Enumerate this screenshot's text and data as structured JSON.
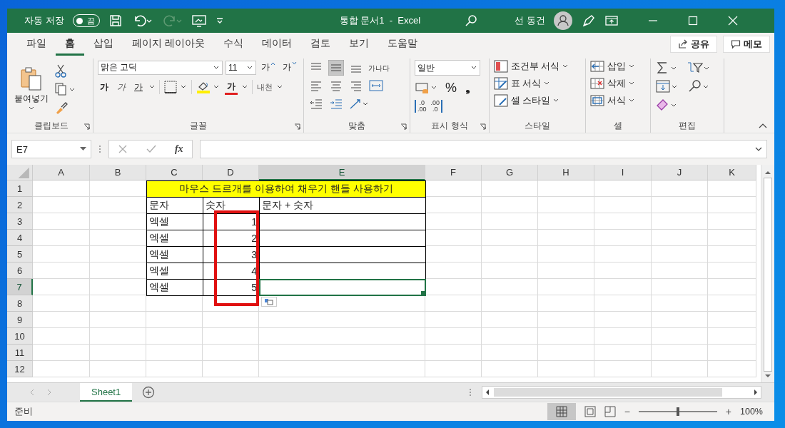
{
  "title_bar": {
    "autosave_label": "자동 저장",
    "autosave": {
      "on": false,
      "label": "끔"
    },
    "document_title": "통합 문서1  -  Excel",
    "user_name": "선 동건"
  },
  "menu_tabs": [
    {
      "label": "파일",
      "selected": false
    },
    {
      "label": "홈",
      "selected": true
    },
    {
      "label": "삽입",
      "selected": false
    },
    {
      "label": "페이지 레이아웃",
      "selected": false
    },
    {
      "label": "수식",
      "selected": false
    },
    {
      "label": "데이터",
      "selected": false
    },
    {
      "label": "검토",
      "selected": false
    },
    {
      "label": "보기",
      "selected": false
    },
    {
      "label": "도움말",
      "selected": false
    }
  ],
  "share_button": "공유",
  "comments_button": "메모",
  "ribbon": {
    "clipboard": {
      "paste_label": "붙여넣기",
      "group_label": "클립보드"
    },
    "font": {
      "font_name": "맑은 고딕",
      "font_size": "11",
      "grow_glyph": "가",
      "shrink_glyph": "가",
      "format_buttons": [
        {
          "kind": "bold",
          "glyph": "가"
        },
        {
          "kind": "italic",
          "glyph": "가"
        },
        {
          "kind": "underline",
          "glyph": "가"
        }
      ],
      "font_color_glyph": "가",
      "phonetic_glyph": "내천",
      "group_label": "글꼴"
    },
    "alignment": {
      "wrap_glyph": "가나다",
      "group_label": "맞춤"
    },
    "number": {
      "format": "일반",
      "percent_glyph": "%",
      "comma_glyph": "❟",
      "decimal_buttons": [
        {
          "kind": "increase",
          "top": ".0",
          "bottom": ".00"
        },
        {
          "kind": "decrease",
          "top": ".00",
          "bottom": ".0"
        }
      ],
      "group_label": "표시 형식"
    },
    "styles": {
      "items": [
        {
          "kind": "conditional",
          "label": "조건부 서식"
        },
        {
          "kind": "table",
          "label": "표 서식"
        },
        {
          "kind": "cell",
          "label": "셀 스타일"
        }
      ],
      "group_label": "스타일"
    },
    "cells": {
      "items": [
        {
          "kind": "insert",
          "label": "삽입"
        },
        {
          "kind": "delete",
          "label": "삭제"
        },
        {
          "kind": "format",
          "label": "서식"
        }
      ],
      "group_label": "셀"
    },
    "editing": {
      "group_label": "편집"
    }
  },
  "formula_bar": {
    "name_box": "E7",
    "function_glyph": "fx"
  },
  "sheet": {
    "columns": [
      {
        "label": "A",
        "selected": false
      },
      {
        "label": "B",
        "selected": false
      },
      {
        "label": "C",
        "selected": false
      },
      {
        "label": "D",
        "selected": false
      },
      {
        "label": "E",
        "selected": true
      },
      {
        "label": "F",
        "selected": false
      },
      {
        "label": "G",
        "selected": false
      },
      {
        "label": "H",
        "selected": false
      },
      {
        "label": "I",
        "selected": false
      },
      {
        "label": "J",
        "selected": false
      },
      {
        "label": "K",
        "selected": false
      }
    ],
    "rows": [
      {
        "label": "1",
        "selected": false
      },
      {
        "label": "2",
        "selected": false
      },
      {
        "label": "3",
        "selected": false
      },
      {
        "label": "4",
        "selected": false
      },
      {
        "label": "5",
        "selected": false
      },
      {
        "label": "6",
        "selected": false
      },
      {
        "label": "7",
        "selected": true
      },
      {
        "label": "8",
        "selected": false
      },
      {
        "label": "9",
        "selected": false
      },
      {
        "label": "10",
        "selected": false
      },
      {
        "label": "11",
        "selected": false
      },
      {
        "label": "12",
        "selected": false
      }
    ]
  },
  "table": {
    "title": "마우스 드르개를 이용하여 채우기 핸들 사용하기",
    "header": [
      "문자",
      "숫자",
      "문자 + 숫자"
    ],
    "rows": [
      {
        "text": "엑셀",
        "number": "1",
        "selected": false
      },
      {
        "text": "엑셀",
        "number": "2",
        "selected": false
      },
      {
        "text": "엑셀",
        "number": "3",
        "selected": false
      },
      {
        "text": "엑셀",
        "number": "4",
        "selected": false
      },
      {
        "text": "엑셀",
        "number": "5",
        "selected": true
      }
    ]
  },
  "sheet_tabs": [
    {
      "label": "Sheet1",
      "selected": true
    }
  ],
  "status_bar": {
    "status": "준비",
    "zoom_minus": "−",
    "zoom_plus": "+",
    "zoom_slider": {
      "level": 0.5
    },
    "zoom": "100%"
  }
}
